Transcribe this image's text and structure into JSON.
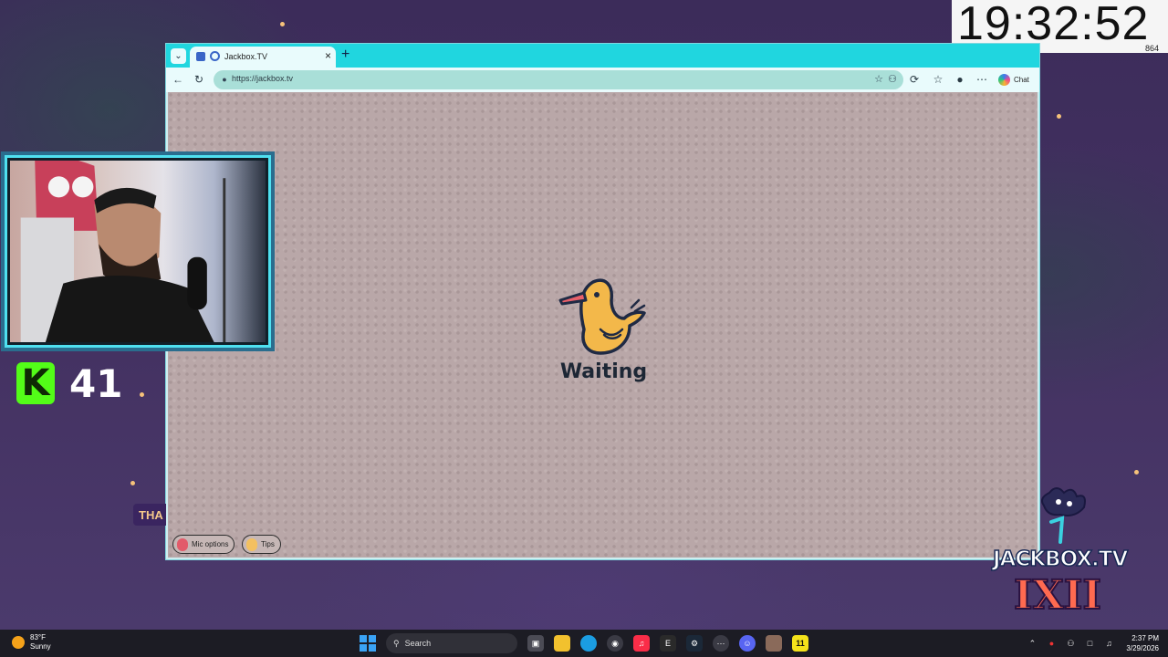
{
  "overlay": {
    "clock": "19:32:52",
    "clock_sub": "864",
    "kick_followers": "41",
    "side_banner": "THA"
  },
  "browser": {
    "tab_title": "Jackbox.TV",
    "url": "https://jackbox.tv",
    "chat_label": "Chat",
    "new_tab": "+",
    "tab_close": "×"
  },
  "page": {
    "status": "Waiting",
    "mic_options": "Mic options",
    "tips": "Tips"
  },
  "logo": {
    "name": "JACKBOX.TV",
    "number": "IXII"
  },
  "taskbar": {
    "temp": "83°F",
    "condition": "Sunny",
    "search_placeholder": "Search",
    "time": "2:37 PM",
    "date": "3/29/2026"
  },
  "colors": {
    "browser_accent": "#20d6df",
    "kick_green": "#53fc18",
    "page_bg": "#b9a7a8"
  }
}
